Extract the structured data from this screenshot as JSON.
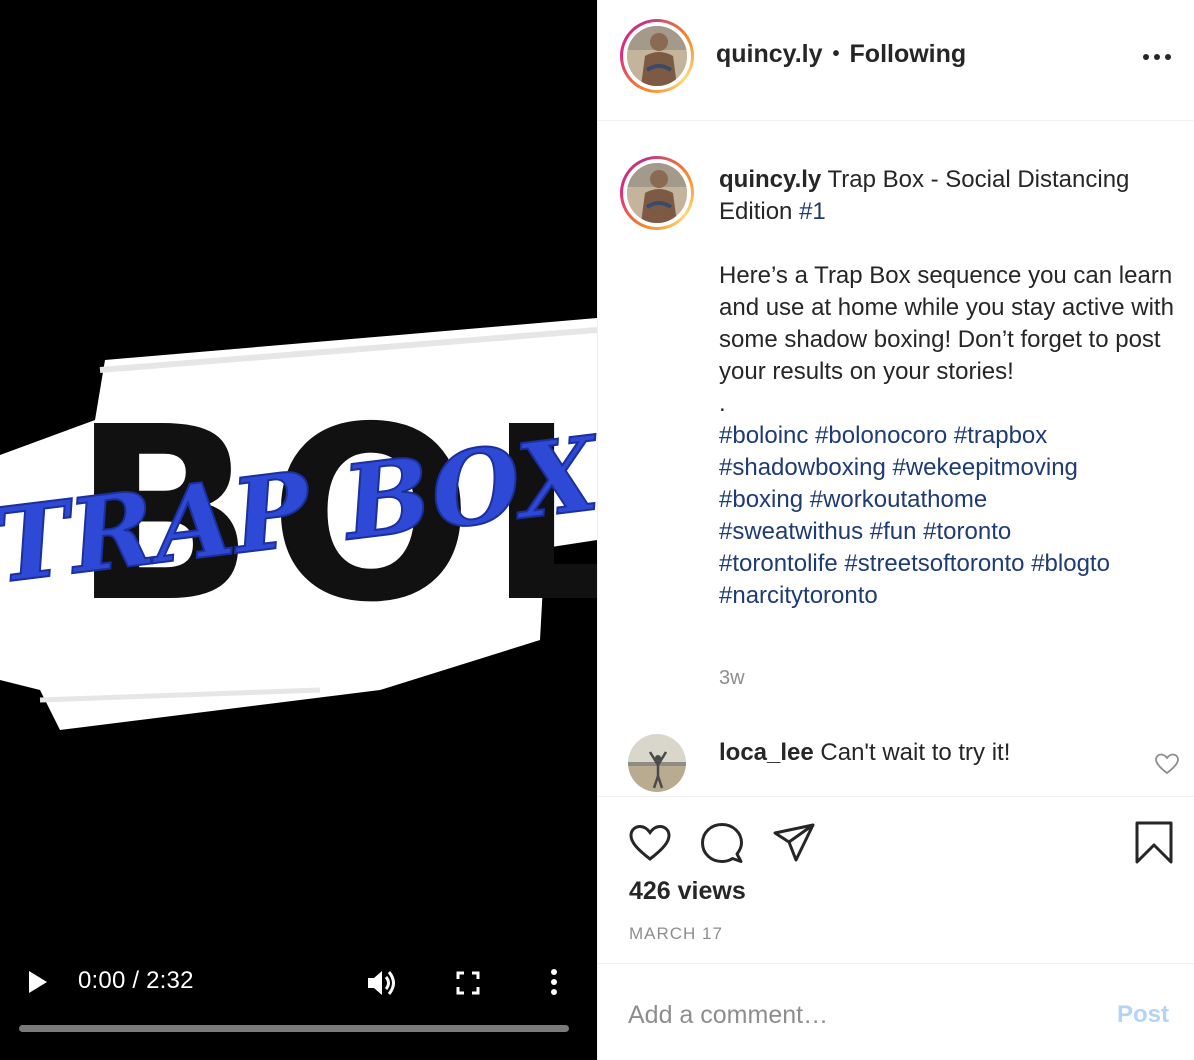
{
  "video": {
    "art_words": [
      "BOLO",
      "TRAP BOX"
    ],
    "current_time": "0:00",
    "duration": "2:32",
    "time_label": "0:00 / 2:32",
    "progress": 0.0,
    "icons": [
      "play-icon",
      "volume-icon",
      "fullscreen-icon",
      "more-vertical-icon"
    ]
  },
  "header": {
    "username": "quincy.ly",
    "separator": "•",
    "follow_status": "Following",
    "more_icon": "more-horizontal-icon"
  },
  "caption": {
    "username": "quincy.ly",
    "title": "Trap Box - Social Distancing Edition",
    "title_tag": "#1",
    "body": "Here’s a Trap Box sequence you can learn and use at home while you stay active with some shadow boxing! Don’t forget to post your results on your stories!",
    "spacer": ".",
    "hashtags": [
      "#boloinc",
      "#bolonocoro",
      "#trapbox",
      "#shadowboxing",
      "#wekeepitmoving",
      "#boxing",
      "#workoutathome",
      "#sweatwithus",
      "#fun",
      "#toronto",
      "#torontolife",
      "#streetsoftoronto",
      "#blogto",
      "#narcitytoronto"
    ],
    "age": "3w"
  },
  "comments": [
    {
      "username": "loca_lee",
      "text": "Can't wait to try it!",
      "like_icon": "heart-outline-icon"
    }
  ],
  "actions": {
    "icons": [
      "heart-icon",
      "comment-icon",
      "share-icon",
      "bookmark-icon"
    ],
    "views": "426 views",
    "date": "MARCH 17"
  },
  "add_comment": {
    "placeholder": "Add a comment…",
    "post_label": "Post"
  },
  "colors": {
    "hashtag": "#1f3b73",
    "meta_gray": "#8e8e8e",
    "post_disabled": "#b3d4f5",
    "art_blue": "#2d49d6"
  }
}
